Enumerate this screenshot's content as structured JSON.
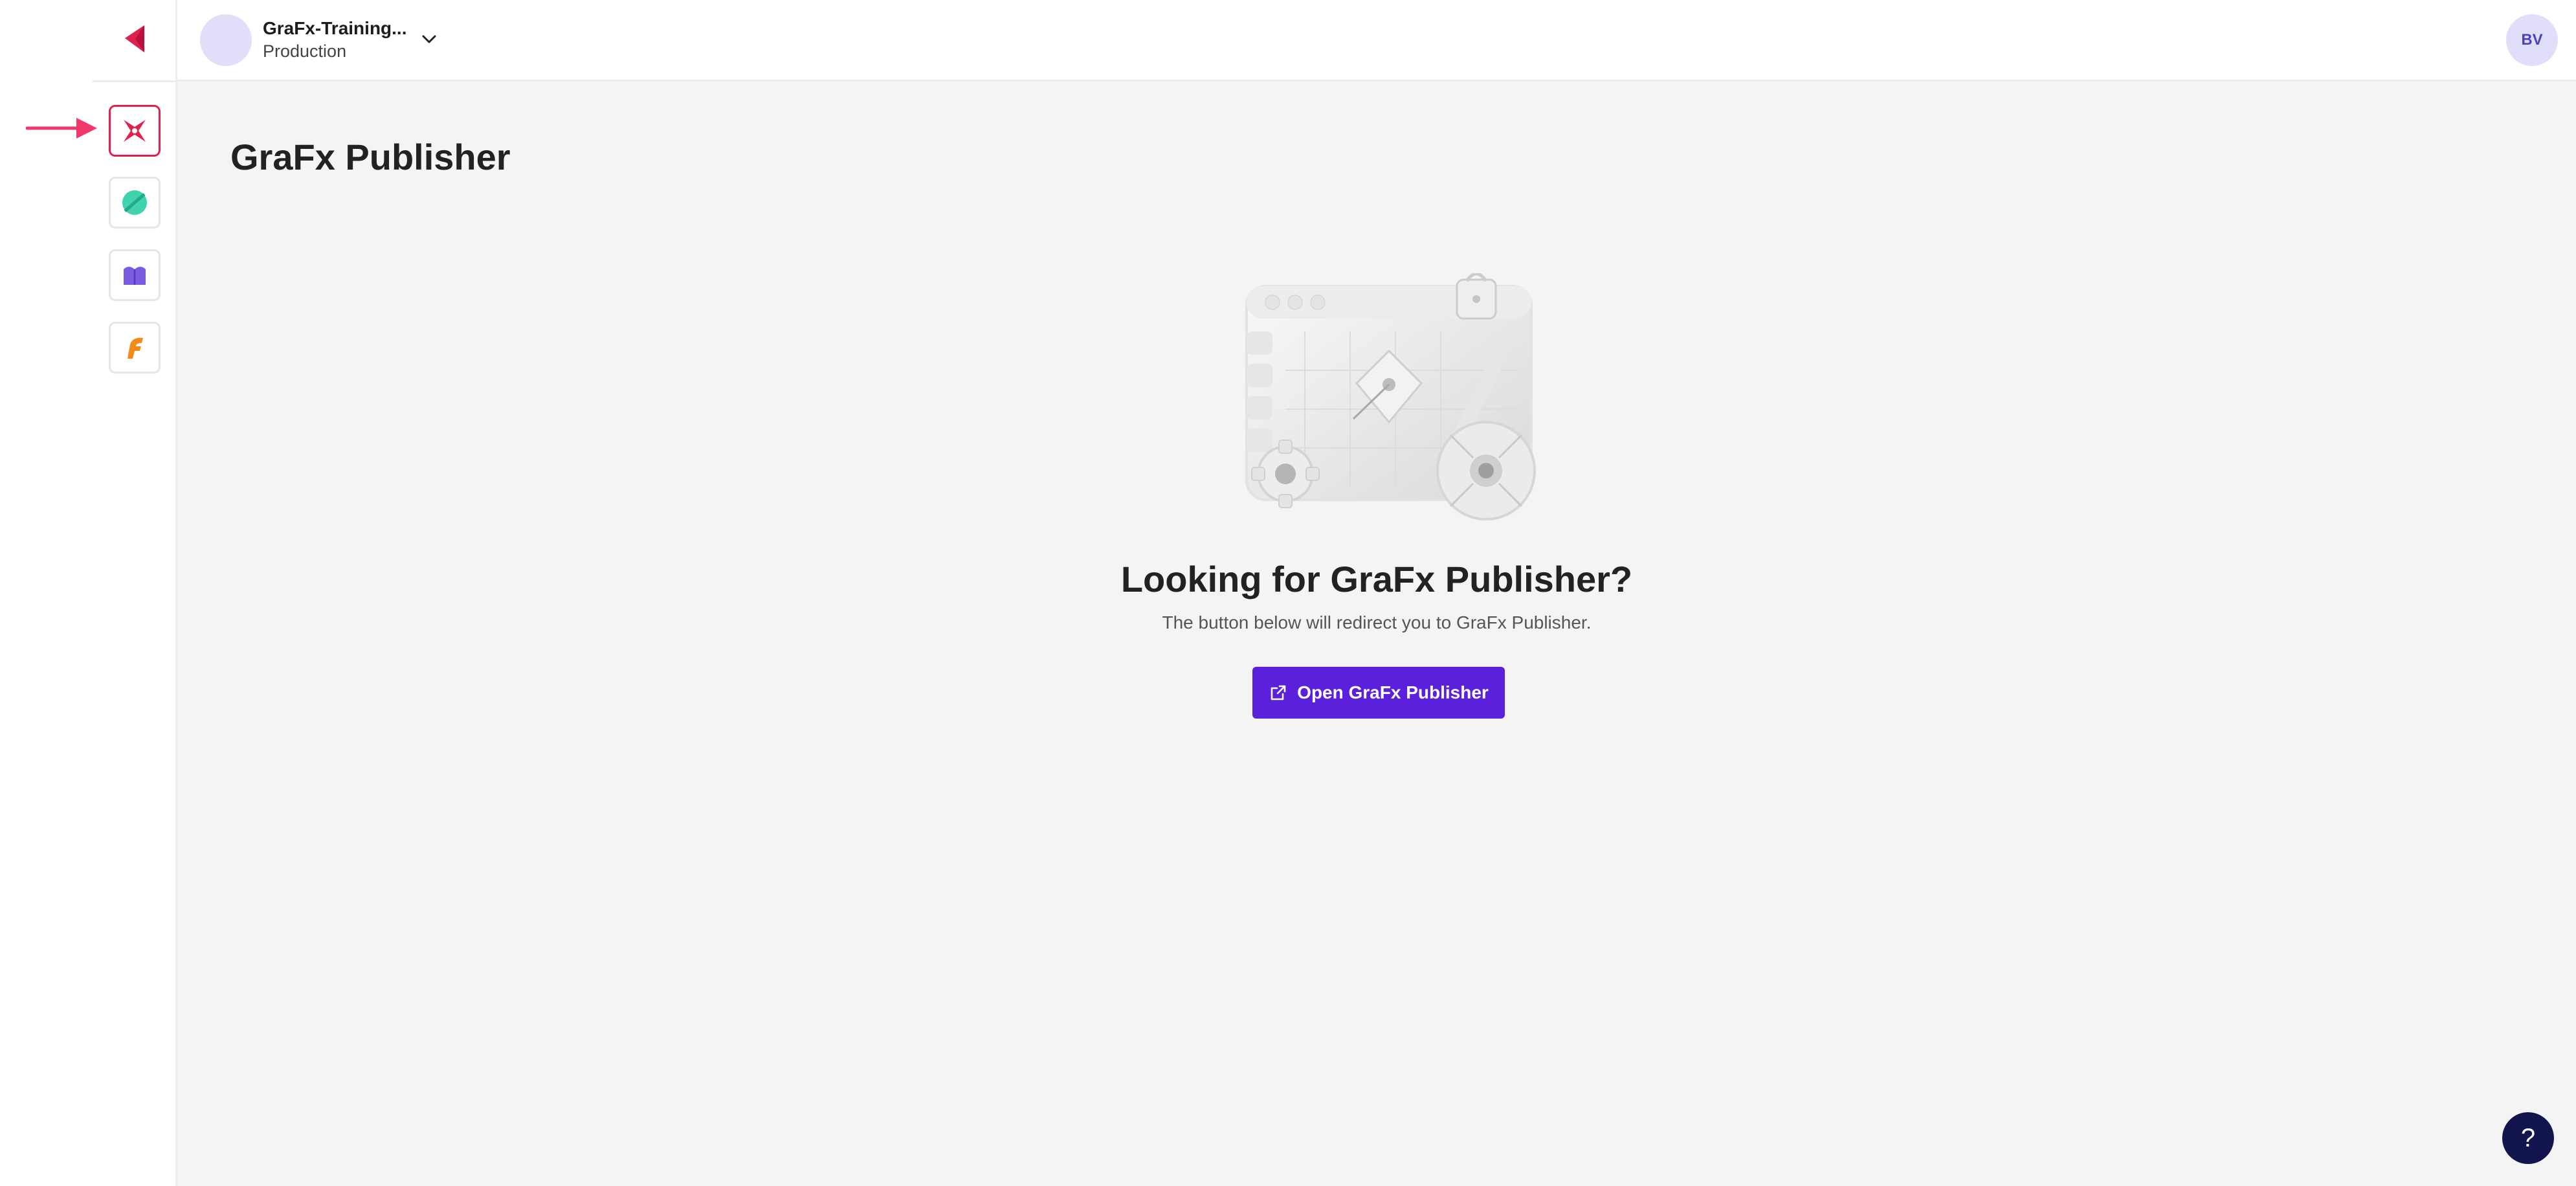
{
  "app": {
    "brand_color": "#e0214f",
    "accent_color": "#5a20dc"
  },
  "sidebar": {
    "items": [
      {
        "name": "grafx-publisher",
        "icon": "publisher-icon",
        "color": "#e0214f",
        "active": true
      },
      {
        "name": "grafx-app-2",
        "icon": "teal-leaf-icon",
        "color": "#3fd3b0",
        "active": false
      },
      {
        "name": "grafx-app-3",
        "icon": "purple-book-icon",
        "color": "#7b5ce0",
        "active": false
      },
      {
        "name": "grafx-app-4",
        "icon": "orange-f-icon",
        "color": "#f28a18",
        "active": false
      }
    ]
  },
  "header": {
    "environment_name": "GraFx-Training...",
    "environment_type": "Production",
    "user_initials": "BV"
  },
  "main": {
    "page_title": "GraFx Publisher",
    "headline": "Looking for GraFx Publisher?",
    "description": "The button below will redirect you to GraFx Publisher.",
    "button_label": "Open GraFx Publisher"
  },
  "help": {
    "label": "?"
  }
}
